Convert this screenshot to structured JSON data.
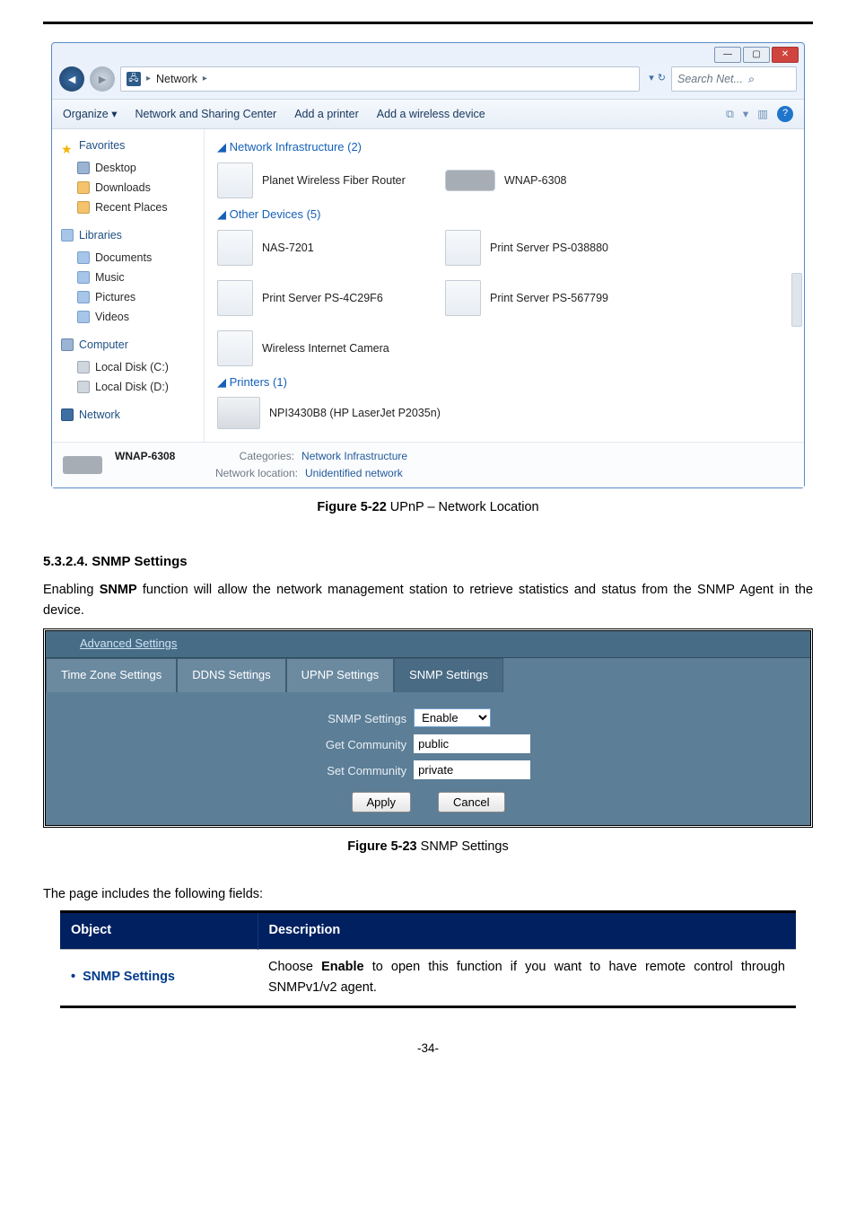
{
  "win7": {
    "nav_back_glyph": "◄",
    "nav_fwd_glyph": "►",
    "breadcrumb_icon_glyph": "🖧",
    "breadcrumb_text": "Network",
    "breadcrumb_sep": "▸",
    "refresh_dropdown": "▾",
    "refresh_glyph": "↻",
    "search_placeholder": "Search Net...",
    "search_icon_glyph": "⌕",
    "toolbar": {
      "organize": "Organize ▾",
      "sharing_center": "Network and Sharing Center",
      "add_printer": "Add a printer",
      "add_wireless": "Add a wireless device",
      "view_icon_glyph": "⧉",
      "view_dropdown": "▾",
      "view_preview_glyph": "▥",
      "help_glyph": "?"
    },
    "win_min": "—",
    "win_max": "▢",
    "win_close": "✕",
    "sidebar": {
      "favorites": "Favorites",
      "desktop": "Desktop",
      "downloads": "Downloads",
      "recent": "Recent Places",
      "libraries": "Libraries",
      "documents": "Documents",
      "music": "Music",
      "pictures": "Pictures",
      "videos": "Videos",
      "computer": "Computer",
      "disk_c": "Local Disk (C:)",
      "disk_d": "Local Disk (D:)",
      "network": "Network"
    },
    "groups": {
      "infra": "Network Infrastructure (2)",
      "other": "Other Devices (5)",
      "printers": "Printers (1)"
    },
    "devices": {
      "fiber_router": "Planet Wireless Fiber Router",
      "wnap": "WNAP-6308",
      "nas": "NAS-7201",
      "ps1": "Print Server PS-038880",
      "ps2": "Print Server PS-4C29F6",
      "ps3": "Print Server PS-567799",
      "camera": "Wireless Internet Camera",
      "printer": "NPI3430B8 (HP LaserJet P2035n)"
    },
    "bottom": {
      "name": "WNAP-6308",
      "cat_key": "Categories:",
      "cat_val": "Network Infrastructure",
      "loc_key": "Network location:",
      "loc_val": "Unidentified network"
    },
    "collapse_glyph": "◢"
  },
  "figure1_label": "Figure 5-22",
  "figure1_title": " UPnP – Network Location",
  "section_heading": "5.3.2.4.  SNMP Settings",
  "body_paragraph": "Enabling SNMP function will allow the network management station to retrieve statistics and status from the SNMP Agent in the device.",
  "body_part1": "Enabling ",
  "body_snmp": "SNMP",
  "body_part2": " function will allow the network management station to retrieve statistics and status from the SNMP Agent in the device.",
  "adv": {
    "crumb": "Advanced Settings",
    "tabs": [
      "Time Zone Settings",
      "DDNS Settings",
      "UPNP Settings",
      "SNMP Settings"
    ],
    "lbl_snmp": "SNMP Settings",
    "val_snmp": "Enable",
    "lbl_get": "Get Community",
    "val_get": "public",
    "lbl_set": "Set Community",
    "val_set": "private",
    "btn_apply": "Apply",
    "btn_cancel": "Cancel"
  },
  "figure2_label": "Figure 5-23",
  "figure2_title": " SNMP Settings",
  "para_fields": "The page includes the following fields:",
  "table": {
    "h_object": "Object",
    "h_desc": "Description",
    "obj1": "SNMP Settings",
    "bullet": "•",
    "desc1a": "Choose ",
    "desc1b": "Enable",
    "desc1c": " to open this function if you want to have remote control through SNMPv1/v2 agent."
  },
  "page_number": "-34-"
}
